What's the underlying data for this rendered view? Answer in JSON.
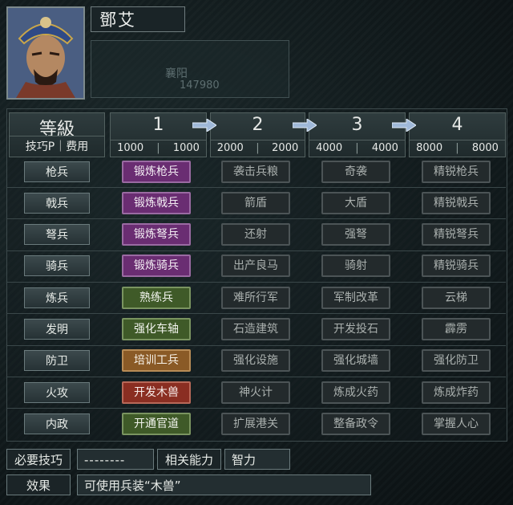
{
  "officer": {
    "name": "鄧艾",
    "city": "襄阳",
    "number": "147980"
  },
  "header": {
    "level_label": "等級",
    "cost_label": "技巧P｜费用",
    "levels": [
      {
        "label": "1",
        "tp": "1000",
        "cost": "1000"
      },
      {
        "label": "2",
        "tp": "2000",
        "cost": "2000"
      },
      {
        "label": "3",
        "tp": "4000",
        "cost": "4000"
      },
      {
        "label": "4",
        "tp": "8000",
        "cost": "8000"
      }
    ]
  },
  "categories": [
    {
      "name": "枪兵",
      "techs": [
        {
          "label": "锻炼枪兵",
          "state": "purple"
        },
        {
          "label": "袭击兵粮",
          "state": "gray"
        },
        {
          "label": "奇袭",
          "state": "gray"
        },
        {
          "label": "精锐枪兵",
          "state": "gray"
        }
      ]
    },
    {
      "name": "戟兵",
      "techs": [
        {
          "label": "锻炼戟兵",
          "state": "purple"
        },
        {
          "label": "箭盾",
          "state": "gray"
        },
        {
          "label": "大盾",
          "state": "gray"
        },
        {
          "label": "精锐戟兵",
          "state": "gray"
        }
      ]
    },
    {
      "name": "弩兵",
      "techs": [
        {
          "label": "锻炼弩兵",
          "state": "purple"
        },
        {
          "label": "还射",
          "state": "gray"
        },
        {
          "label": "强弩",
          "state": "gray"
        },
        {
          "label": "精锐弩兵",
          "state": "gray"
        }
      ]
    },
    {
      "name": "骑兵",
      "techs": [
        {
          "label": "锻炼骑兵",
          "state": "purple"
        },
        {
          "label": "出产良马",
          "state": "gray"
        },
        {
          "label": "骑射",
          "state": "gray"
        },
        {
          "label": "精锐骑兵",
          "state": "gray"
        }
      ]
    },
    {
      "name": "炼兵",
      "techs": [
        {
          "label": "熟练兵",
          "state": "green"
        },
        {
          "label": "难所行军",
          "state": "gray"
        },
        {
          "label": "军制改革",
          "state": "gray"
        },
        {
          "label": "云梯",
          "state": "gray"
        }
      ]
    },
    {
      "name": "发明",
      "techs": [
        {
          "label": "强化车轴",
          "state": "green"
        },
        {
          "label": "石造建筑",
          "state": "gray"
        },
        {
          "label": "开发投石",
          "state": "gray"
        },
        {
          "label": "霹雳",
          "state": "gray"
        }
      ]
    },
    {
      "name": "防卫",
      "techs": [
        {
          "label": "培训工兵",
          "state": "orange"
        },
        {
          "label": "强化设施",
          "state": "gray"
        },
        {
          "label": "强化城墙",
          "state": "gray"
        },
        {
          "label": "强化防卫",
          "state": "gray"
        }
      ]
    },
    {
      "name": "火攻",
      "techs": [
        {
          "label": "开发木兽",
          "state": "red"
        },
        {
          "label": "神火计",
          "state": "gray"
        },
        {
          "label": "炼成火药",
          "state": "gray"
        },
        {
          "label": "炼成炸药",
          "state": "gray"
        }
      ]
    },
    {
      "name": "内政",
      "techs": [
        {
          "label": "开通官道",
          "state": "green"
        },
        {
          "label": "扩展港关",
          "state": "gray"
        },
        {
          "label": "整备政令",
          "state": "gray"
        },
        {
          "label": "掌握人心",
          "state": "gray"
        }
      ]
    }
  ],
  "footer": {
    "required_label": "必要技巧",
    "required_value": "--------",
    "ability_label": "相关能力",
    "ability_value": "智力",
    "effect_label": "效果",
    "effect_value": "可使用兵装“木兽”"
  },
  "colors": {
    "purple": "#6a2d72",
    "green": "#3f5a28",
    "orange": "#8a5a26",
    "red": "#8a2e22",
    "arrow": "#9fb8d8"
  }
}
